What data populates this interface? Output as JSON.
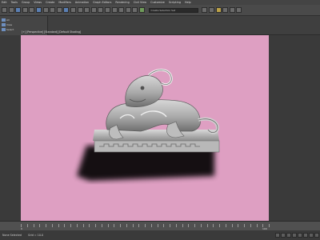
{
  "menubar": {
    "items": [
      "Edit",
      "Tools",
      "Group",
      "Views",
      "Create",
      "Modifiers",
      "Animation",
      "Graph Editors",
      "Rendering",
      "Civil View",
      "Customize",
      "Scripting",
      "Help"
    ]
  },
  "toolbar": {
    "selection_set_placeholder": "Create Selection Set"
  },
  "left_panel": {
    "rows": [
      "All",
      "View",
      "Select"
    ]
  },
  "viewport": {
    "label": "[+] [Perspective] [Standard] [Default Shading]",
    "background_color": "#de9fc2",
    "object_icon": "stone-lion-statue-render"
  },
  "timeline": {
    "frame_start": "0",
    "frame_end": "100"
  },
  "statusbar": {
    "selected": "None Selected",
    "grid": "Grid = 10.0"
  }
}
